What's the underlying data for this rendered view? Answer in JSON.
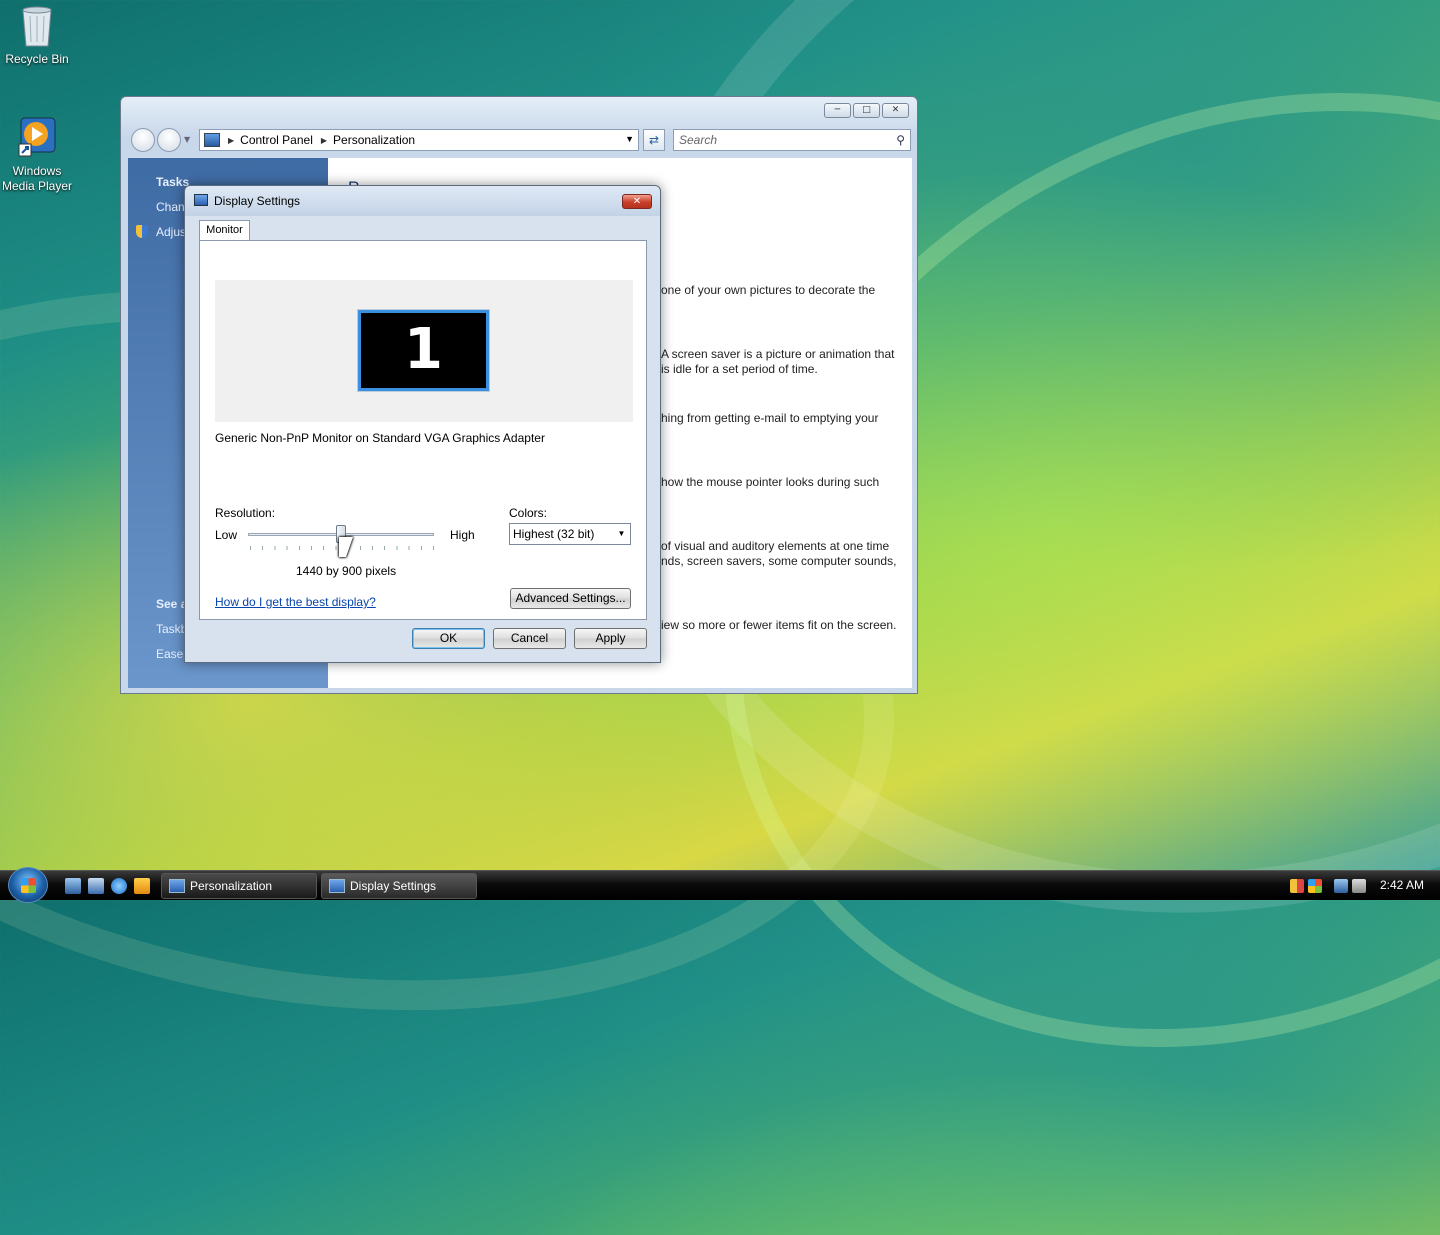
{
  "desktop": {
    "icons": [
      {
        "label": "Recycle Bin"
      },
      {
        "label_line1": "Windows",
        "label_line2": "Media Player"
      }
    ]
  },
  "explorer": {
    "breadcrumb": [
      "Control Panel",
      "Personalization"
    ],
    "search_placeholder": "Search",
    "left_pane": {
      "tasks_header": "Tasks",
      "task_1": "Chan",
      "task_2": "Adjus",
      "see_also_header": "See a",
      "see_also_1": "Taskb",
      "see_also_2": "Ease"
    },
    "content": {
      "heading_fragment": "P",
      "desc_1": "one of your own pictures to decorate the",
      "desc_2a": "A screen saver is a picture or animation that",
      "desc_2b": "is idle for a set period of time.",
      "desc_3": "hing from getting e-mail to emptying your",
      "desc_4": "how the mouse pointer looks during such",
      "desc_5a": "of visual and auditory elements at one time",
      "desc_5b": "nds, screen savers, some computer sounds,",
      "desc_6": "iew so more or fewer items fit on the screen."
    }
  },
  "dialog": {
    "title": "Display Settings",
    "tab": "Monitor",
    "monitor_number": "1",
    "monitor_name": "Generic Non-PnP Monitor on Standard VGA Graphics Adapter",
    "resolution_label": "Resolution:",
    "low_label": "Low",
    "high_label": "High",
    "resolution_value": "1440 by 900 pixels",
    "resolution_slider_fraction": 0.5,
    "colors_label": "Colors:",
    "colors_value": "Highest (32 bit)",
    "help_link": "How do I get the best display?",
    "advanced_button": "Advanced Settings...",
    "ok_button": "OK",
    "cancel_button": "Cancel",
    "apply_button": "Apply"
  },
  "taskbar": {
    "tasks": [
      "Personalization",
      "Display Settings"
    ],
    "clock": "2:42 AM"
  },
  "colors": {
    "accent": "#3b8fe0",
    "link": "#0645ad",
    "close_button": "#c7402a",
    "left_pane": "#4f7bb5"
  }
}
